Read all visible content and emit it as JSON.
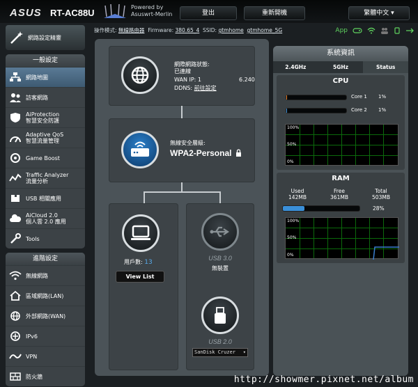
{
  "header": {
    "logo": "ASUS",
    "model": "RT-AC88U",
    "powered_line1": "Powered by",
    "powered_line2": "Asuswrt-Merlin",
    "logout": "登出",
    "reboot": "重新開機",
    "language": "繁體中文 ▾"
  },
  "statusbar": {
    "mode_label": "操作模式:",
    "mode_value": "無線路由器",
    "fw_label": "Firmware:",
    "fw_value": "380.65_4",
    "ssid_label": "SSID:",
    "ssid1": "gtmhome",
    "ssid2": "gtmhome_5G",
    "app_label": "App"
  },
  "sidebar": {
    "quick_setup": "網路設定精靈",
    "general_title": "一般設定",
    "general_items": [
      {
        "name": "network-map",
        "line1": "網路地圖",
        "line2": "",
        "icon": "network-map-icon",
        "active": true
      },
      {
        "name": "guest-network",
        "line1": "訪客網路",
        "line2": "",
        "icon": "guest-network-icon",
        "active": false
      },
      {
        "name": "aiprotection",
        "line1": "AiProtection",
        "line2": "智慧安全防護",
        "icon": "shield-icon",
        "active": false
      },
      {
        "name": "adaptive-qos",
        "line1": "Adaptive QoS",
        "line2": "智慧流量管理",
        "icon": "qos-icon",
        "active": false
      },
      {
        "name": "game-boost",
        "line1": "Game Boost",
        "line2": "",
        "icon": "game-boost-icon",
        "active": false
      },
      {
        "name": "traffic-analyzer",
        "line1": "Traffic Analyzer",
        "line2": "流量分析",
        "icon": "traffic-analyzer-icon",
        "active": false
      },
      {
        "name": "usb-apps",
        "line1": "USB 相關應用",
        "line2": "",
        "icon": "usb-apps-icon",
        "active": false
      },
      {
        "name": "aicloud",
        "line1": "AiCloud 2.0",
        "line2": "個人雲 2.0 應用",
        "icon": "cloud-icon",
        "active": false
      },
      {
        "name": "tools",
        "line1": "Tools",
        "line2": "",
        "icon": "tools-icon",
        "active": false
      }
    ],
    "advanced_title": "進階設定",
    "advanced_items": [
      {
        "name": "wireless",
        "line1": "無線網路",
        "icon": "wifi-icon"
      },
      {
        "name": "lan",
        "line1": "區域網路(LAN)",
        "icon": "home-icon"
      },
      {
        "name": "wan",
        "line1": "外部網路(WAN)",
        "icon": "globe-icon"
      },
      {
        "name": "ipv6",
        "line1": "IPv6",
        "icon": "ipv6-icon"
      },
      {
        "name": "vpn",
        "line1": "VPN",
        "icon": "vpn-icon"
      },
      {
        "name": "firewall",
        "line1": "防火牆",
        "icon": "firewall-icon"
      }
    ]
  },
  "internet": {
    "status_label": "網際網路狀態:",
    "status_value": "已連線",
    "wan_ip_label": "WAN IP: 1",
    "wan_ip_rest": "6.240",
    "ddns_label": "DDNS:",
    "ddns_value": "前往設定"
  },
  "wireless": {
    "security_label": "無線安全層級:",
    "security_value": "WPA2-Personal"
  },
  "clients": {
    "label": "用戶數:",
    "count": "13",
    "view_list": "View List"
  },
  "usb30": {
    "label": "USB 3.0",
    "status": "無裝置"
  },
  "usb20": {
    "label": "USB 2.0",
    "device": "SanDisk Cruzer"
  },
  "system": {
    "title": "系統資訊",
    "tabs": [
      "2.4GHz",
      "5GHz",
      "Status"
    ],
    "cpu_title": "CPU",
    "cores": [
      {
        "label": "Core 1",
        "value": "1%",
        "fraction": 0.01
      },
      {
        "label": "Core 2",
        "value": "1%",
        "fraction": 0.01
      }
    ],
    "pct_ticks": [
      "100%",
      "50%",
      "0%"
    ],
    "ram_title": "RAM",
    "used_label": "Used",
    "used_value": "142MB",
    "free_label": "Free",
    "free_value": "361MB",
    "total_label": "Total",
    "total_value": "503MB",
    "ram_pct": "28%",
    "ram_fraction": 0.28
  },
  "watermark": "http://showmer.pixnet.net/album",
  "colors": {
    "accent": "#3a8fd8",
    "graph_line": "#3a7fd0",
    "app_green": "#5fd35f"
  }
}
